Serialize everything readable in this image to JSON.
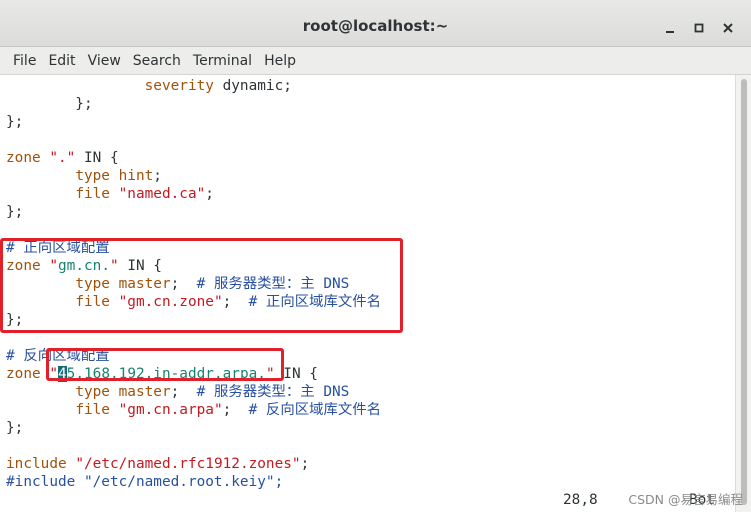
{
  "window": {
    "title": "root@localhost:~",
    "controls": [
      "minimize-icon",
      "maximize-icon",
      "close-icon"
    ]
  },
  "menubar": [
    "File",
    "Edit",
    "View",
    "Search",
    "Terminal",
    "Help"
  ],
  "colors": {
    "keyword": "#a0520a",
    "string": "#c4191f",
    "comment": "#2850a0",
    "zone_name": "#17826e",
    "cursor_bg": "#116c78",
    "highlight_box": "#e0212a"
  },
  "lines": [
    {
      "segs": [
        [
          "",
          "                "
        ],
        [
          "kw",
          "severity"
        ],
        [
          "",
          " dynamic;"
        ]
      ]
    },
    {
      "segs": [
        [
          "",
          "        };"
        ]
      ]
    },
    {
      "segs": [
        [
          "",
          "};"
        ]
      ]
    },
    {
      "segs": []
    },
    {
      "segs": [
        [
          "kw",
          "zone"
        ],
        [
          "",
          " "
        ],
        [
          "str",
          "\".\""
        ],
        [
          "",
          " IN {"
        ]
      ]
    },
    {
      "segs": [
        [
          "",
          "        "
        ],
        [
          "kw",
          "type"
        ],
        [
          "",
          " "
        ],
        [
          "kw",
          "hint"
        ],
        [
          "",
          ";"
        ]
      ]
    },
    {
      "segs": [
        [
          "",
          "        "
        ],
        [
          "kw",
          "file"
        ],
        [
          "",
          " "
        ],
        [
          "str",
          "\"named.ca\""
        ],
        [
          "",
          ";"
        ]
      ]
    },
    {
      "segs": [
        [
          "",
          "};"
        ]
      ]
    },
    {
      "segs": []
    },
    {
      "segs": [
        [
          "cmt",
          "# 正向区域配置"
        ]
      ]
    },
    {
      "segs": [
        [
          "kw",
          "zone"
        ],
        [
          "",
          " "
        ],
        [
          "str",
          "\""
        ],
        [
          "zn",
          "gm.cn."
        ],
        [
          "str",
          "\""
        ],
        [
          "",
          " IN {"
        ]
      ]
    },
    {
      "segs": [
        [
          "",
          "        "
        ],
        [
          "kw",
          "type"
        ],
        [
          "",
          " "
        ],
        [
          "kw",
          "master"
        ],
        [
          "",
          ";  "
        ],
        [
          "cmt",
          "# 服务器类型：主 DNS"
        ]
      ]
    },
    {
      "segs": [
        [
          "",
          "        "
        ],
        [
          "kw",
          "file"
        ],
        [
          "",
          " "
        ],
        [
          "str",
          "\"gm.cn.zone\""
        ],
        [
          "",
          ";  "
        ],
        [
          "cmt",
          "# 正向区域库文件名"
        ]
      ]
    },
    {
      "segs": [
        [
          "",
          "};"
        ]
      ]
    },
    {
      "segs": []
    },
    {
      "segs": [
        [
          "cmt",
          "# 反向区域配置"
        ]
      ]
    },
    {
      "segs": [
        [
          "kw",
          "zone"
        ],
        [
          "",
          " "
        ],
        [
          "str",
          "\""
        ],
        [
          "cursor",
          "4"
        ],
        [
          "zn",
          "5.168.192.in-addr.arpa."
        ],
        [
          "str",
          "\""
        ],
        [
          "",
          " IN {"
        ]
      ]
    },
    {
      "segs": [
        [
          "",
          "        "
        ],
        [
          "kw",
          "type"
        ],
        [
          "",
          " "
        ],
        [
          "kw",
          "master"
        ],
        [
          "",
          ";  "
        ],
        [
          "cmt",
          "# 服务器类型：主 DNS"
        ]
      ]
    },
    {
      "segs": [
        [
          "",
          "        "
        ],
        [
          "kw",
          "file"
        ],
        [
          "",
          " "
        ],
        [
          "str",
          "\"gm.cn.arpa\""
        ],
        [
          "",
          ";  "
        ],
        [
          "cmt",
          "# 反向区域库文件名"
        ]
      ]
    },
    {
      "segs": [
        [
          "",
          "};"
        ]
      ]
    },
    {
      "segs": []
    },
    {
      "segs": [
        [
          "kw",
          "include"
        ],
        [
          "",
          " "
        ],
        [
          "str",
          "\"/etc/named.rfc1912.zones\""
        ],
        [
          "",
          ";"
        ]
      ]
    },
    {
      "segs": [
        [
          "cmt",
          "#include \"/etc/named.root.keiy\";"
        ]
      ]
    }
  ],
  "status": {
    "position": "28,8",
    "scroll": "Bot"
  },
  "watermark": "CSDN @易言易编程"
}
